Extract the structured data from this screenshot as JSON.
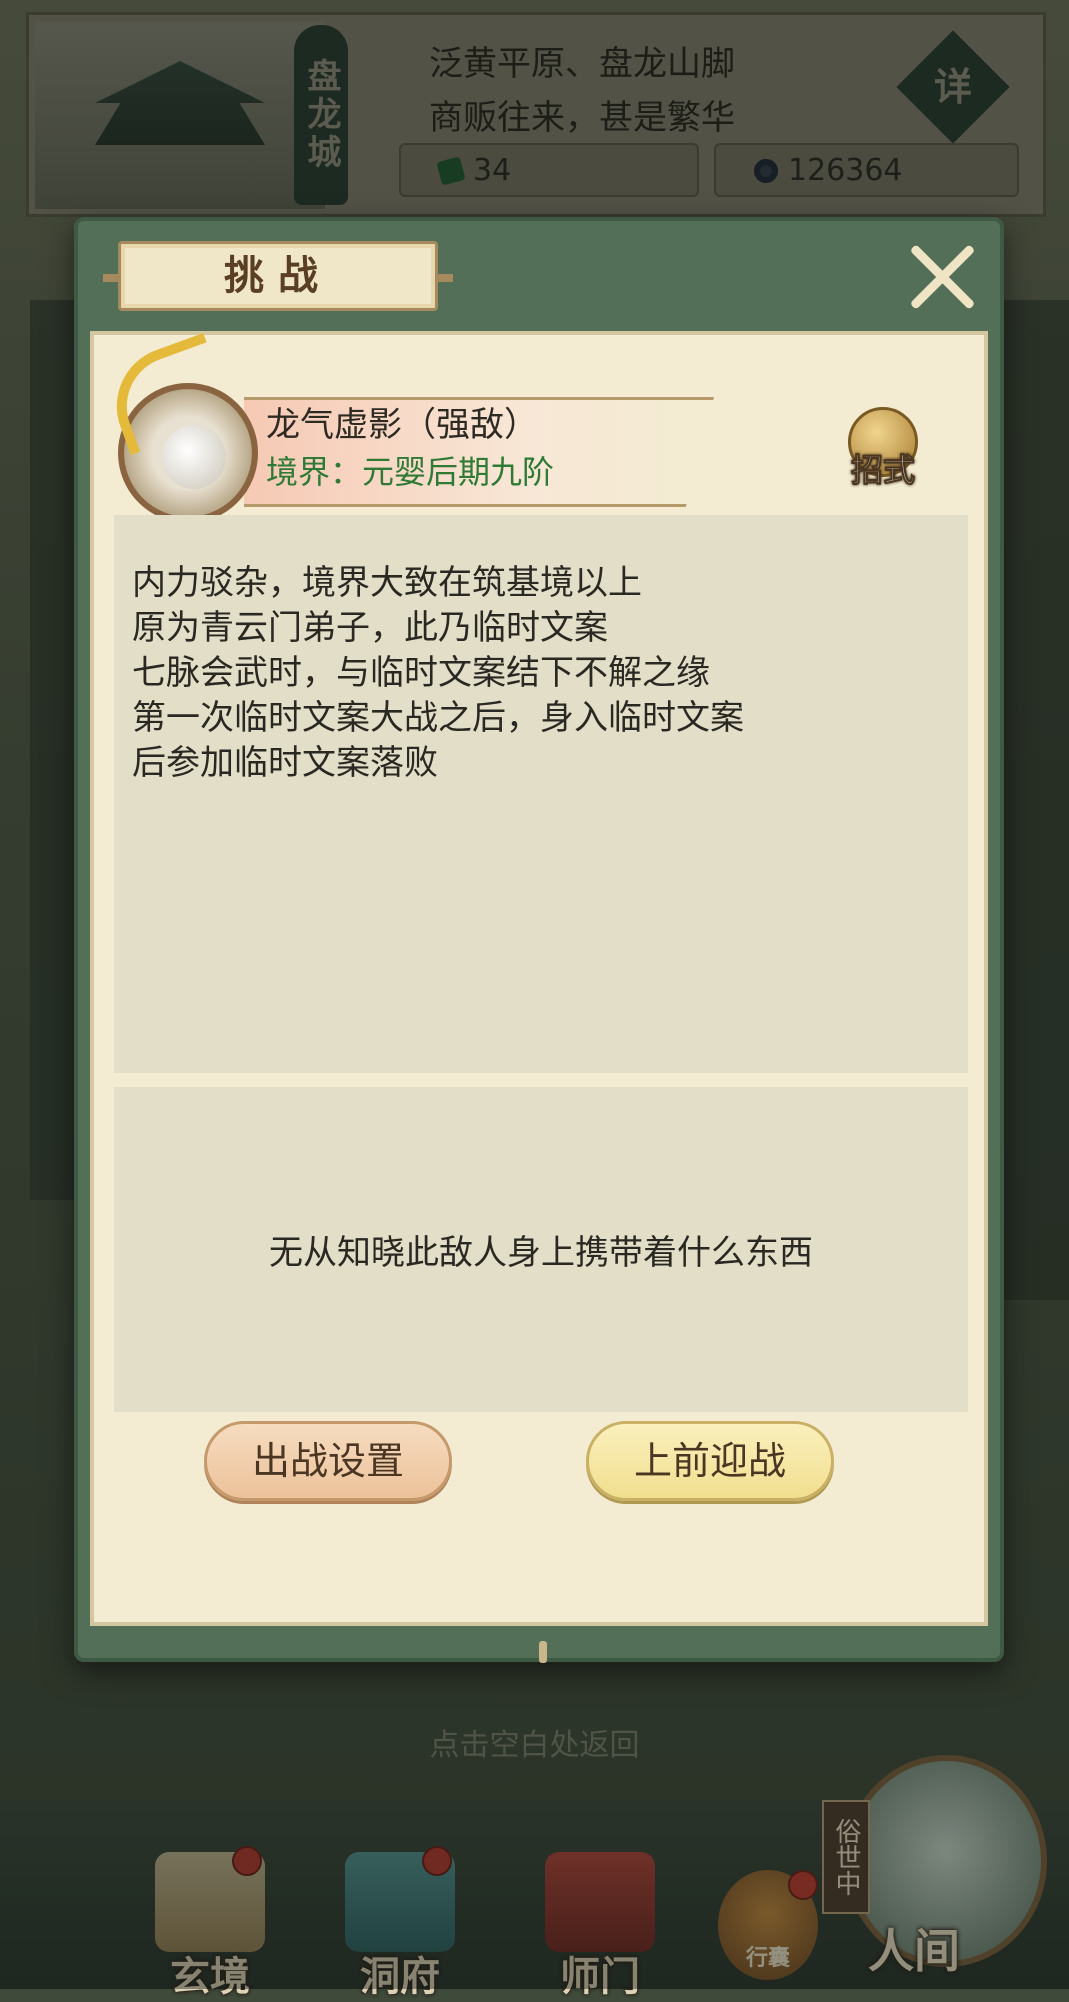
{
  "location": {
    "city_name": "盘龙城",
    "description_line1": "泛黄平原、盘龙山脚",
    "description_line2": "商贩往来，甚是繁华",
    "detail_label": "详",
    "jade_amount": "34",
    "coin_amount": "126364"
  },
  "dialog": {
    "title": "挑战",
    "enemy": {
      "name": "龙气虚影（强敌）",
      "realm": "境界：元婴后期九阶",
      "skill_label": "招式"
    },
    "description": [
      "内力驳杂，境界大致在筑基境以上",
      "原为青云门弟子，此乃临时文案",
      "七脉会武时，与临时文案结下不解之缘",
      "第一次临时文案大战之后，身入临时文案",
      "后参加临时文案落败"
    ],
    "loot_text": "无从知晓此敌人身上携带着什么东西",
    "buttons": {
      "setup": "出战设置",
      "fight": "上前迎战"
    }
  },
  "hint": "点击空白处返回",
  "bottom_nav": {
    "items": [
      {
        "label": "玄境"
      },
      {
        "label": "洞府"
      },
      {
        "label": "师门"
      }
    ],
    "bag_label": "行囊",
    "status_tag": "俗世中",
    "world_label": "人间"
  },
  "colors": {
    "accent_green": "#546f57",
    "realm_green": "#2f7a35",
    "badge_red": "#c03a2d"
  }
}
